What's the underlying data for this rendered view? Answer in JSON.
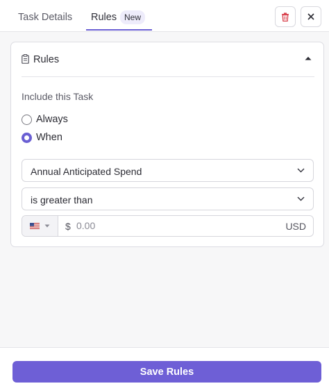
{
  "tabs": {
    "details_label": "Task Details",
    "rules_label": "Rules",
    "rules_badge": "New"
  },
  "header_actions": {
    "delete_icon": "trash-icon",
    "close_icon": "close-icon"
  },
  "rules_card": {
    "title": "Rules",
    "title_icon": "clipboard-icon",
    "collapse_icon": "caret-up-icon",
    "include_label": "Include this Task",
    "radio_options": [
      {
        "label": "Always",
        "checked": false
      },
      {
        "label": "When",
        "checked": true
      }
    ],
    "field_select": {
      "value": "Annual Anticipated Spend"
    },
    "operator_select": {
      "value": "is greater than"
    },
    "amount": {
      "currency_flag": "us-flag-icon",
      "currency_symbol": "$",
      "placeholder": "0.00",
      "value": "",
      "currency_code": "USD"
    }
  },
  "footer": {
    "save_label": "Save Rules"
  },
  "colors": {
    "accent": "#6a5fd3",
    "button": "#6e5fd6",
    "delete_icon": "#d9434e"
  }
}
